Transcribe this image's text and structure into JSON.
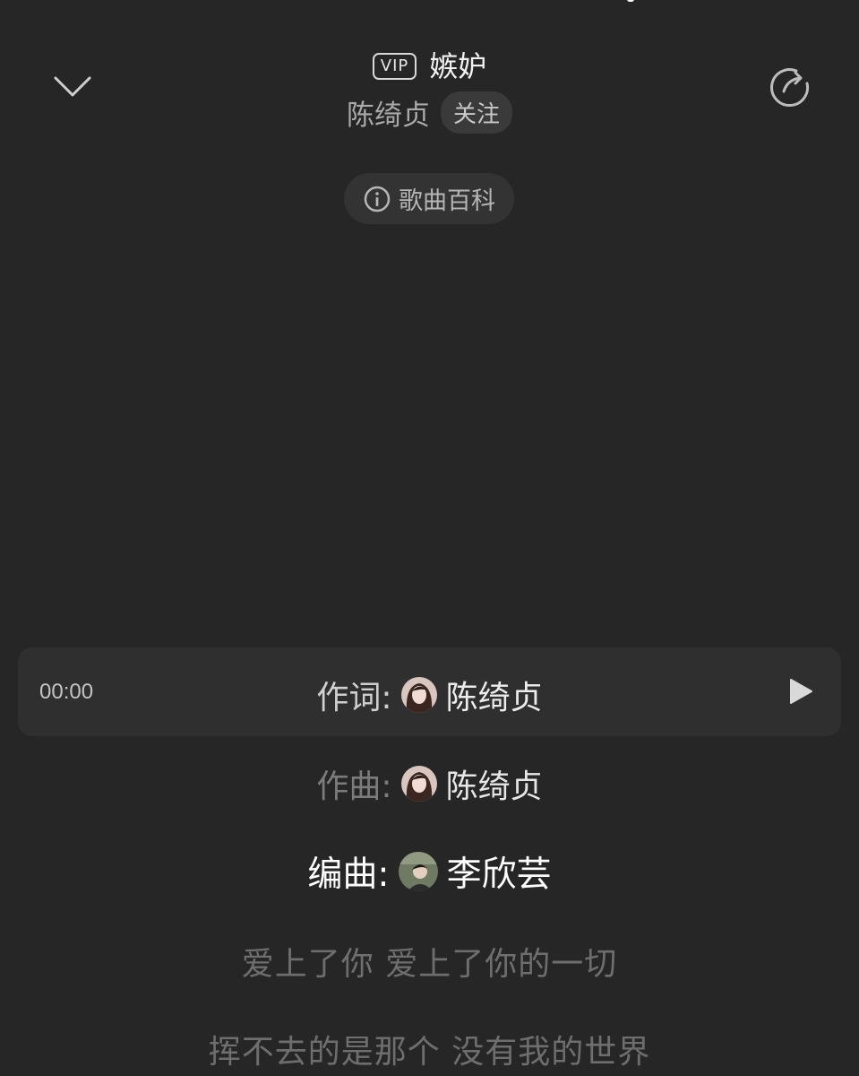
{
  "header": {
    "vip_label": "VIP",
    "song_title": "嫉妒",
    "artist": "陈绮贞",
    "follow_label": "关注",
    "wiki_label": "歌曲百科",
    "icons": {
      "collapse": "chevron-down-icon",
      "share": "share-icon",
      "info": "info-icon"
    }
  },
  "lyrics": {
    "current_time": "00:00",
    "credits": [
      {
        "label": "作词:",
        "name": "陈绮贞",
        "avatar": "avatar-chen-qizhen"
      },
      {
        "label": "作曲:",
        "name": "陈绮贞",
        "avatar": "avatar-chen-qizhen"
      },
      {
        "label": "编曲:",
        "name": "李欣芸",
        "avatar": "avatar-li-xinyun"
      }
    ],
    "lines": [
      "爱上了你 爱上了你的一切",
      "挥不去的是那个 没有我的世界"
    ]
  },
  "colors": {
    "background": "#262626",
    "current_line_bg": "#2f2f2f",
    "pill_bg": "#333333",
    "highlight_text": "#ffffff",
    "dim_text": "#6e6e6e"
  }
}
